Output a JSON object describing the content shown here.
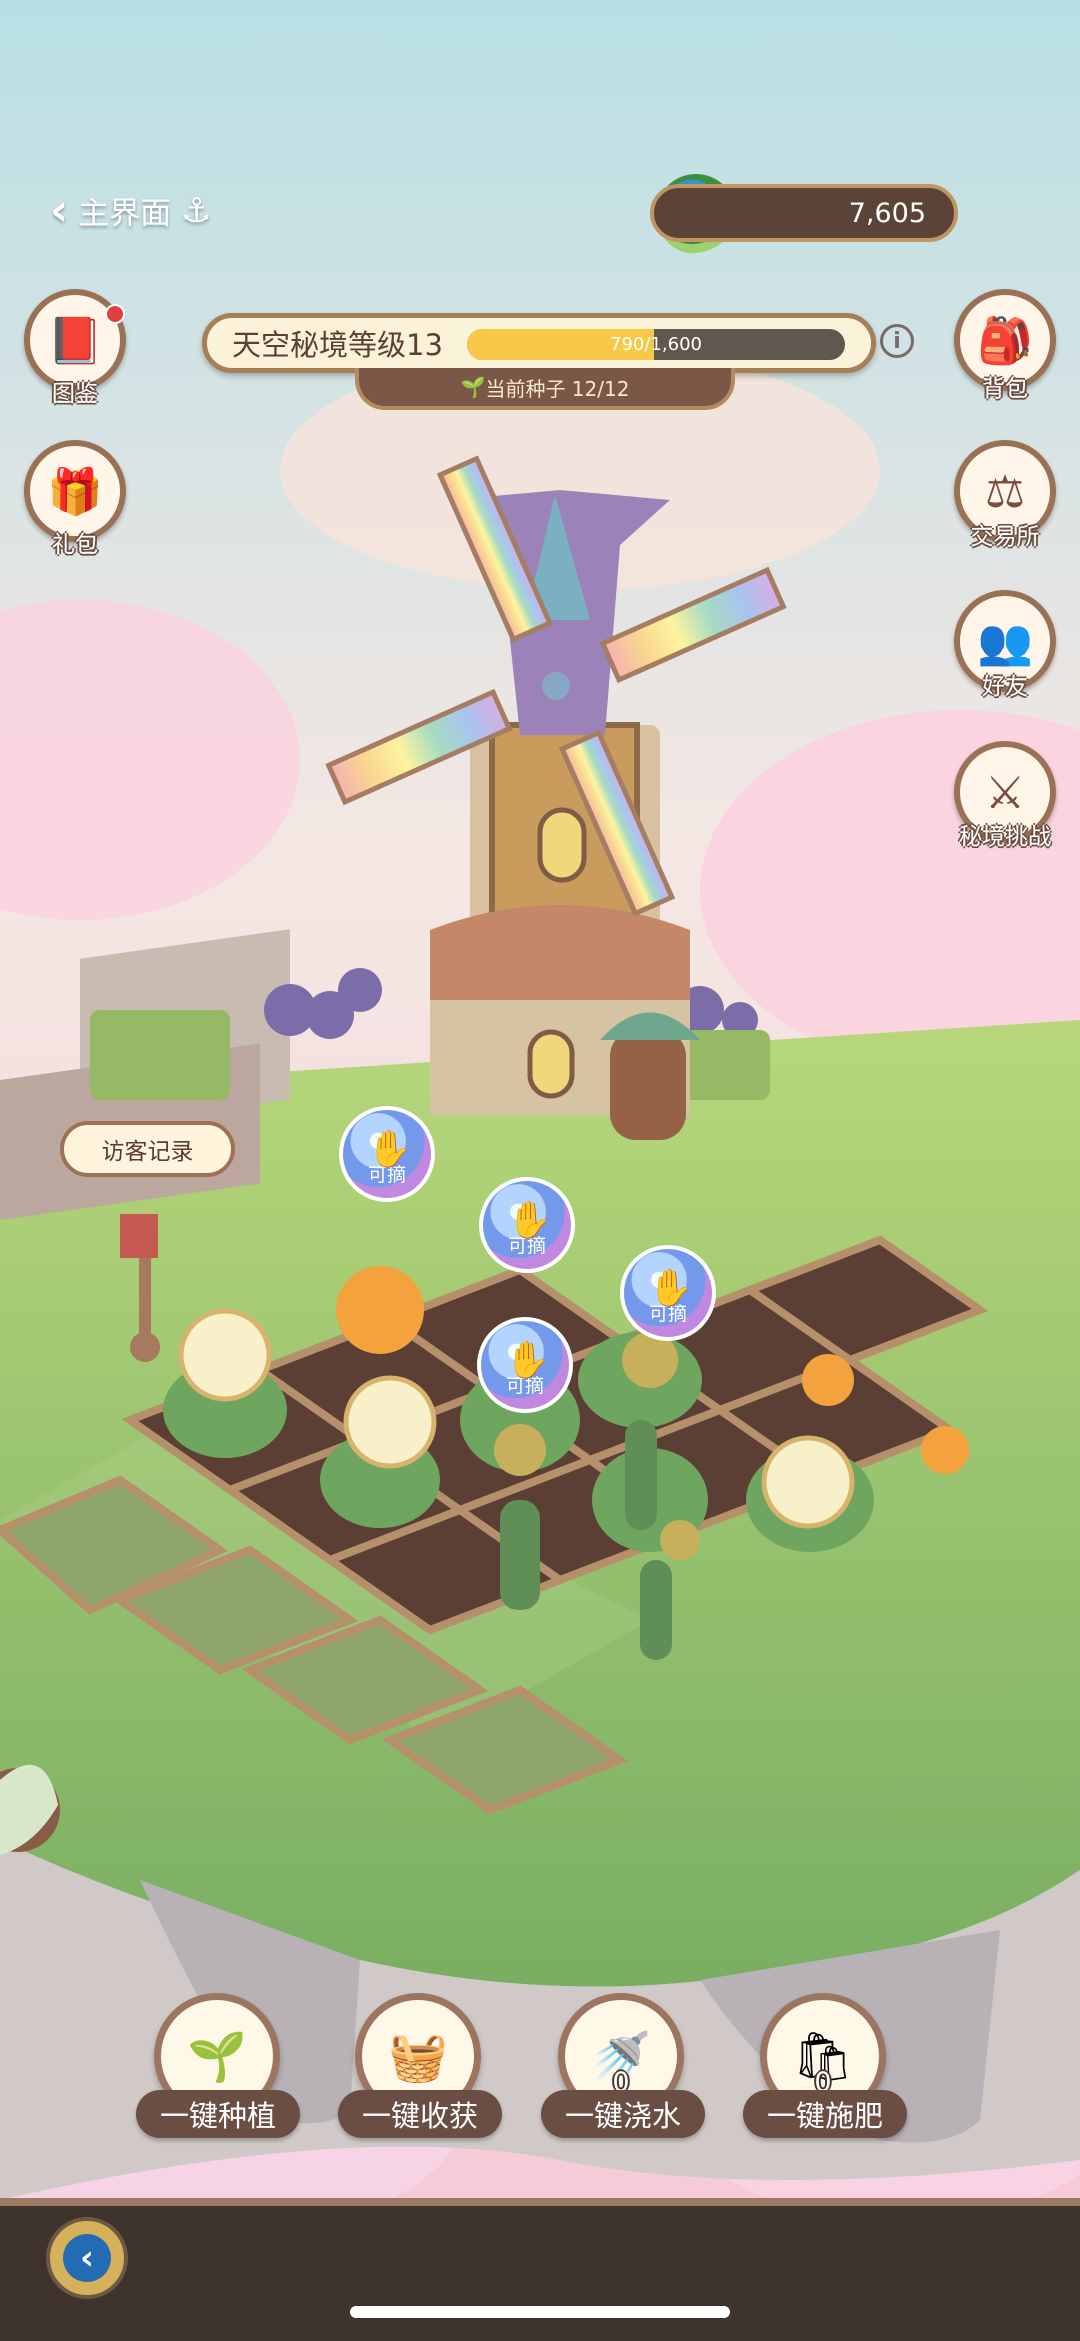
{
  "header": {
    "back_label": "主界面",
    "currency_value": "7,605",
    "anchor_icon": "anchor-icon",
    "back_icon": "chevron-left-icon"
  },
  "level": {
    "title": "天空秘境等级13",
    "progress_text": "790/1,600",
    "progress_fraction": 0.49375,
    "seed_text": "当前种子 12/12"
  },
  "left_buttons": [
    {
      "label": "图鉴",
      "icon": "book-icon",
      "has_badge": true
    },
    {
      "label": "礼包",
      "icon": "gift-icon"
    }
  ],
  "right_buttons": [
    {
      "label": "背包",
      "icon": "bag-icon"
    },
    {
      "label": "交易所",
      "icon": "scale-icon"
    },
    {
      "label": "好友",
      "icon": "friends-icon"
    },
    {
      "label": "秘境挑战",
      "icon": "swords-icon"
    }
  ],
  "visitor_label": "访客记录",
  "harvest_bubbles": [
    {
      "label": "可摘"
    },
    {
      "label": "可摘"
    },
    {
      "label": "可摘"
    },
    {
      "label": "可摘"
    }
  ],
  "actions": [
    {
      "label": "一键种植",
      "icon": "seedling-icon"
    },
    {
      "label": "一键收获",
      "icon": "basket-icon"
    },
    {
      "label": "一键浇水",
      "icon": "watering-can-icon",
      "count": "0"
    },
    {
      "label": "一键施肥",
      "icon": "fertilizer-bag-icon",
      "count": "0"
    }
  ],
  "colors": {
    "sky": "#f5e6df",
    "grass": "#8bbb6f",
    "soil": "#5a3d32",
    "accent_gold": "#f8c948"
  }
}
